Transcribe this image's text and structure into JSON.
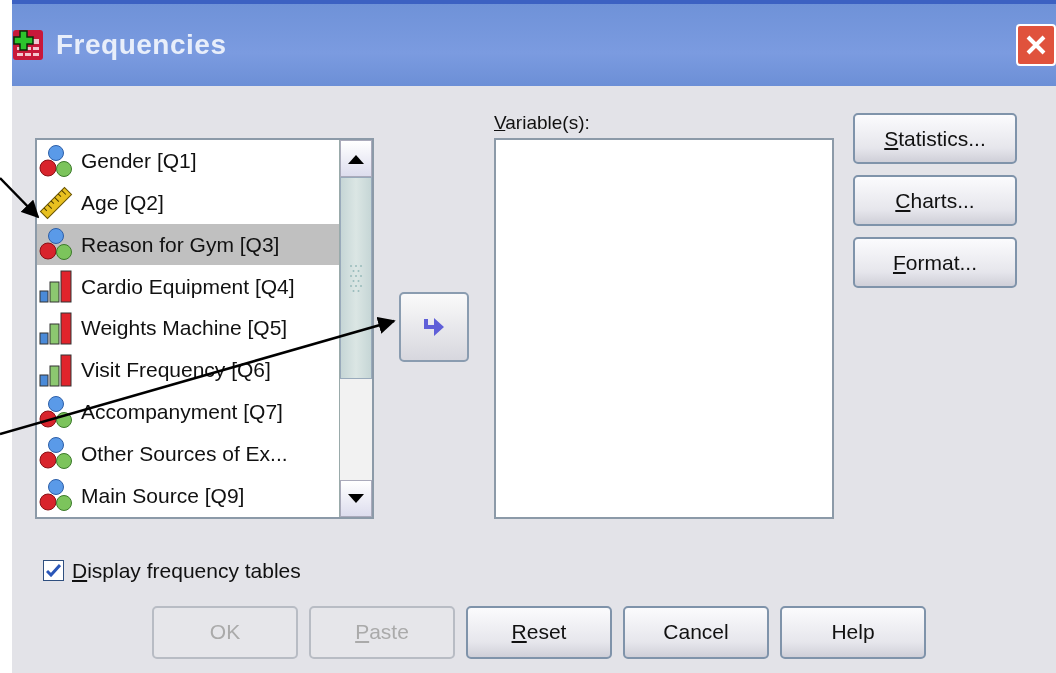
{
  "window": {
    "title": "Frequencies"
  },
  "source_list": {
    "items": [
      {
        "kind": "nominal",
        "label": "Gender [Q1]",
        "selected": false
      },
      {
        "kind": "scale",
        "label": "Age [Q2]",
        "selected": false
      },
      {
        "kind": "nominal",
        "label": "Reason for Gym [Q3]",
        "selected": true
      },
      {
        "kind": "ordinal",
        "label": "Cardio Equipment [Q4]",
        "selected": false
      },
      {
        "kind": "ordinal",
        "label": "Weights Machine [Q5]",
        "selected": false
      },
      {
        "kind": "ordinal",
        "label": "Visit Frequency [Q6]",
        "selected": false
      },
      {
        "kind": "nominal",
        "label": "Accompanyment [Q7]",
        "selected": false
      },
      {
        "kind": "nominal",
        "label": "Other Sources of Ex...",
        "selected": false
      },
      {
        "kind": "nominal",
        "label": "Main Source [Q9]",
        "selected": false
      }
    ]
  },
  "variables": {
    "label_key": "V",
    "label_rest": "ariable(s):"
  },
  "side_buttons": [
    {
      "key": "S",
      "rest": "tatistics..."
    },
    {
      "key": "C",
      "rest": "harts..."
    },
    {
      "key": "F",
      "rest": "ormat..."
    }
  ],
  "display_frequency_tables": {
    "key": "D",
    "rest": "isplay frequency tables",
    "checked": true
  },
  "buttons": [
    {
      "label": "OK",
      "disabled": true
    },
    {
      "key": "P",
      "rest": "aste",
      "disabled": true
    },
    {
      "key": "R",
      "rest": "eset",
      "disabled": false
    },
    {
      "label": "Cancel",
      "disabled": false
    },
    {
      "label": "Help",
      "disabled": false
    }
  ]
}
